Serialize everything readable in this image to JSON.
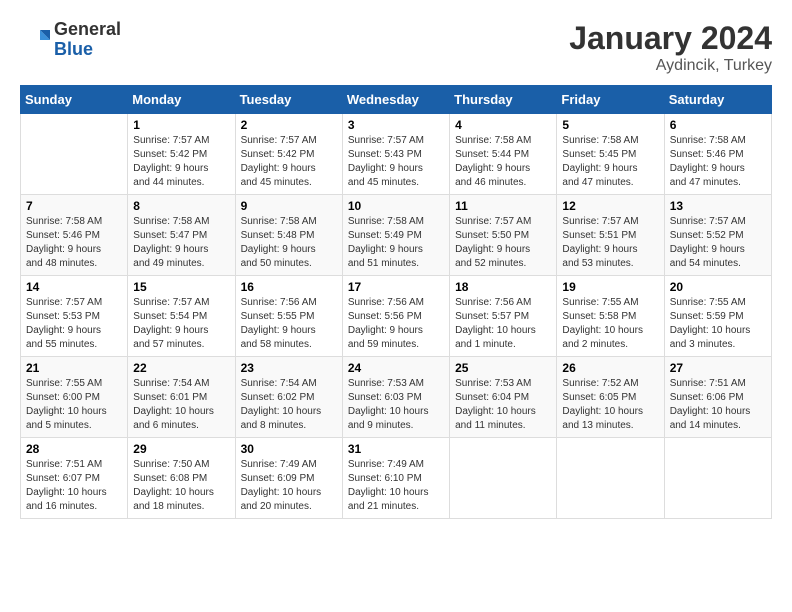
{
  "header": {
    "logo_general": "General",
    "logo_blue": "Blue",
    "month_title": "January 2024",
    "location": "Aydincik, Turkey"
  },
  "days_of_week": [
    "Sunday",
    "Monday",
    "Tuesday",
    "Wednesday",
    "Thursday",
    "Friday",
    "Saturday"
  ],
  "weeks": [
    [
      {
        "day": "",
        "sunrise": "",
        "sunset": "",
        "daylight": ""
      },
      {
        "day": "1",
        "sunrise": "Sunrise: 7:57 AM",
        "sunset": "Sunset: 5:42 PM",
        "daylight": "Daylight: 9 hours and 44 minutes."
      },
      {
        "day": "2",
        "sunrise": "Sunrise: 7:57 AM",
        "sunset": "Sunset: 5:42 PM",
        "daylight": "Daylight: 9 hours and 45 minutes."
      },
      {
        "day": "3",
        "sunrise": "Sunrise: 7:57 AM",
        "sunset": "Sunset: 5:43 PM",
        "daylight": "Daylight: 9 hours and 45 minutes."
      },
      {
        "day": "4",
        "sunrise": "Sunrise: 7:58 AM",
        "sunset": "Sunset: 5:44 PM",
        "daylight": "Daylight: 9 hours and 46 minutes."
      },
      {
        "day": "5",
        "sunrise": "Sunrise: 7:58 AM",
        "sunset": "Sunset: 5:45 PM",
        "daylight": "Daylight: 9 hours and 47 minutes."
      },
      {
        "day": "6",
        "sunrise": "Sunrise: 7:58 AM",
        "sunset": "Sunset: 5:46 PM",
        "daylight": "Daylight: 9 hours and 47 minutes."
      }
    ],
    [
      {
        "day": "7",
        "sunrise": "Sunrise: 7:58 AM",
        "sunset": "Sunset: 5:46 PM",
        "daylight": "Daylight: 9 hours and 48 minutes."
      },
      {
        "day": "8",
        "sunrise": "Sunrise: 7:58 AM",
        "sunset": "Sunset: 5:47 PM",
        "daylight": "Daylight: 9 hours and 49 minutes."
      },
      {
        "day": "9",
        "sunrise": "Sunrise: 7:58 AM",
        "sunset": "Sunset: 5:48 PM",
        "daylight": "Daylight: 9 hours and 50 minutes."
      },
      {
        "day": "10",
        "sunrise": "Sunrise: 7:58 AM",
        "sunset": "Sunset: 5:49 PM",
        "daylight": "Daylight: 9 hours and 51 minutes."
      },
      {
        "day": "11",
        "sunrise": "Sunrise: 7:57 AM",
        "sunset": "Sunset: 5:50 PM",
        "daylight": "Daylight: 9 hours and 52 minutes."
      },
      {
        "day": "12",
        "sunrise": "Sunrise: 7:57 AM",
        "sunset": "Sunset: 5:51 PM",
        "daylight": "Daylight: 9 hours and 53 minutes."
      },
      {
        "day": "13",
        "sunrise": "Sunrise: 7:57 AM",
        "sunset": "Sunset: 5:52 PM",
        "daylight": "Daylight: 9 hours and 54 minutes."
      }
    ],
    [
      {
        "day": "14",
        "sunrise": "Sunrise: 7:57 AM",
        "sunset": "Sunset: 5:53 PM",
        "daylight": "Daylight: 9 hours and 55 minutes."
      },
      {
        "day": "15",
        "sunrise": "Sunrise: 7:57 AM",
        "sunset": "Sunset: 5:54 PM",
        "daylight": "Daylight: 9 hours and 57 minutes."
      },
      {
        "day": "16",
        "sunrise": "Sunrise: 7:56 AM",
        "sunset": "Sunset: 5:55 PM",
        "daylight": "Daylight: 9 hours and 58 minutes."
      },
      {
        "day": "17",
        "sunrise": "Sunrise: 7:56 AM",
        "sunset": "Sunset: 5:56 PM",
        "daylight": "Daylight: 9 hours and 59 minutes."
      },
      {
        "day": "18",
        "sunrise": "Sunrise: 7:56 AM",
        "sunset": "Sunset: 5:57 PM",
        "daylight": "Daylight: 10 hours and 1 minute."
      },
      {
        "day": "19",
        "sunrise": "Sunrise: 7:55 AM",
        "sunset": "Sunset: 5:58 PM",
        "daylight": "Daylight: 10 hours and 2 minutes."
      },
      {
        "day": "20",
        "sunrise": "Sunrise: 7:55 AM",
        "sunset": "Sunset: 5:59 PM",
        "daylight": "Daylight: 10 hours and 3 minutes."
      }
    ],
    [
      {
        "day": "21",
        "sunrise": "Sunrise: 7:55 AM",
        "sunset": "Sunset: 6:00 PM",
        "daylight": "Daylight: 10 hours and 5 minutes."
      },
      {
        "day": "22",
        "sunrise": "Sunrise: 7:54 AM",
        "sunset": "Sunset: 6:01 PM",
        "daylight": "Daylight: 10 hours and 6 minutes."
      },
      {
        "day": "23",
        "sunrise": "Sunrise: 7:54 AM",
        "sunset": "Sunset: 6:02 PM",
        "daylight": "Daylight: 10 hours and 8 minutes."
      },
      {
        "day": "24",
        "sunrise": "Sunrise: 7:53 AM",
        "sunset": "Sunset: 6:03 PM",
        "daylight": "Daylight: 10 hours and 9 minutes."
      },
      {
        "day": "25",
        "sunrise": "Sunrise: 7:53 AM",
        "sunset": "Sunset: 6:04 PM",
        "daylight": "Daylight: 10 hours and 11 minutes."
      },
      {
        "day": "26",
        "sunrise": "Sunrise: 7:52 AM",
        "sunset": "Sunset: 6:05 PM",
        "daylight": "Daylight: 10 hours and 13 minutes."
      },
      {
        "day": "27",
        "sunrise": "Sunrise: 7:51 AM",
        "sunset": "Sunset: 6:06 PM",
        "daylight": "Daylight: 10 hours and 14 minutes."
      }
    ],
    [
      {
        "day": "28",
        "sunrise": "Sunrise: 7:51 AM",
        "sunset": "Sunset: 6:07 PM",
        "daylight": "Daylight: 10 hours and 16 minutes."
      },
      {
        "day": "29",
        "sunrise": "Sunrise: 7:50 AM",
        "sunset": "Sunset: 6:08 PM",
        "daylight": "Daylight: 10 hours and 18 minutes."
      },
      {
        "day": "30",
        "sunrise": "Sunrise: 7:49 AM",
        "sunset": "Sunset: 6:09 PM",
        "daylight": "Daylight: 10 hours and 20 minutes."
      },
      {
        "day": "31",
        "sunrise": "Sunrise: 7:49 AM",
        "sunset": "Sunset: 6:10 PM",
        "daylight": "Daylight: 10 hours and 21 minutes."
      },
      {
        "day": "",
        "sunrise": "",
        "sunset": "",
        "daylight": ""
      },
      {
        "day": "",
        "sunrise": "",
        "sunset": "",
        "daylight": ""
      },
      {
        "day": "",
        "sunrise": "",
        "sunset": "",
        "daylight": ""
      }
    ]
  ]
}
